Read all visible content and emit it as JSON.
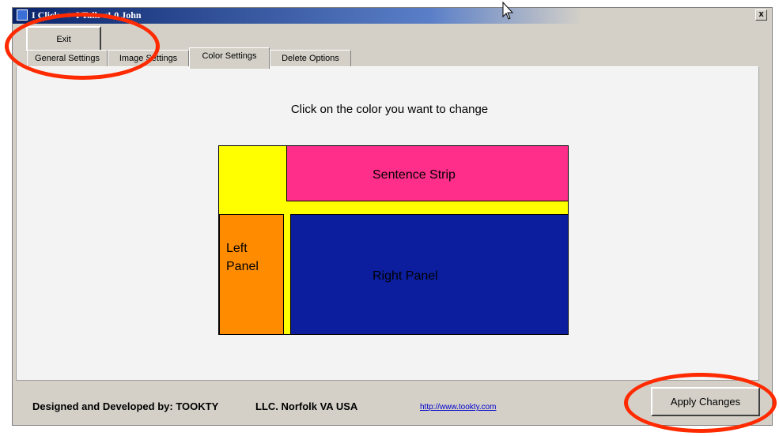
{
  "window": {
    "title": "I Click --> I Talk v1.0 John",
    "close_label": "x"
  },
  "toolbar": {
    "exit_label": "Exit"
  },
  "tabs": [
    {
      "label": "General Settings",
      "active": false
    },
    {
      "label": "Image Settings",
      "active": false
    },
    {
      "label": "Color Settings",
      "active": true
    },
    {
      "label": "Delete Options",
      "active": false
    }
  ],
  "panel": {
    "prompt": "Click on the color you want to change",
    "zones": {
      "background": {
        "color": "#ffff00"
      },
      "sentence_strip": {
        "label": "Sentence Strip",
        "color": "#ff2e8a"
      },
      "left_panel": {
        "label_line1": "Left",
        "label_line2": "Panel",
        "color": "#ff8c00"
      },
      "right_panel": {
        "label": "Right Panel",
        "color": "#0c1e9e"
      }
    }
  },
  "footer": {
    "credit": "Designed and Developed by: TOOKTY",
    "location": "LLC. Norfolk VA USA",
    "link": "http://www.tookty.com",
    "apply_label": "Apply Changes"
  },
  "annotations": {
    "highlight_color": "#ff2a00"
  }
}
